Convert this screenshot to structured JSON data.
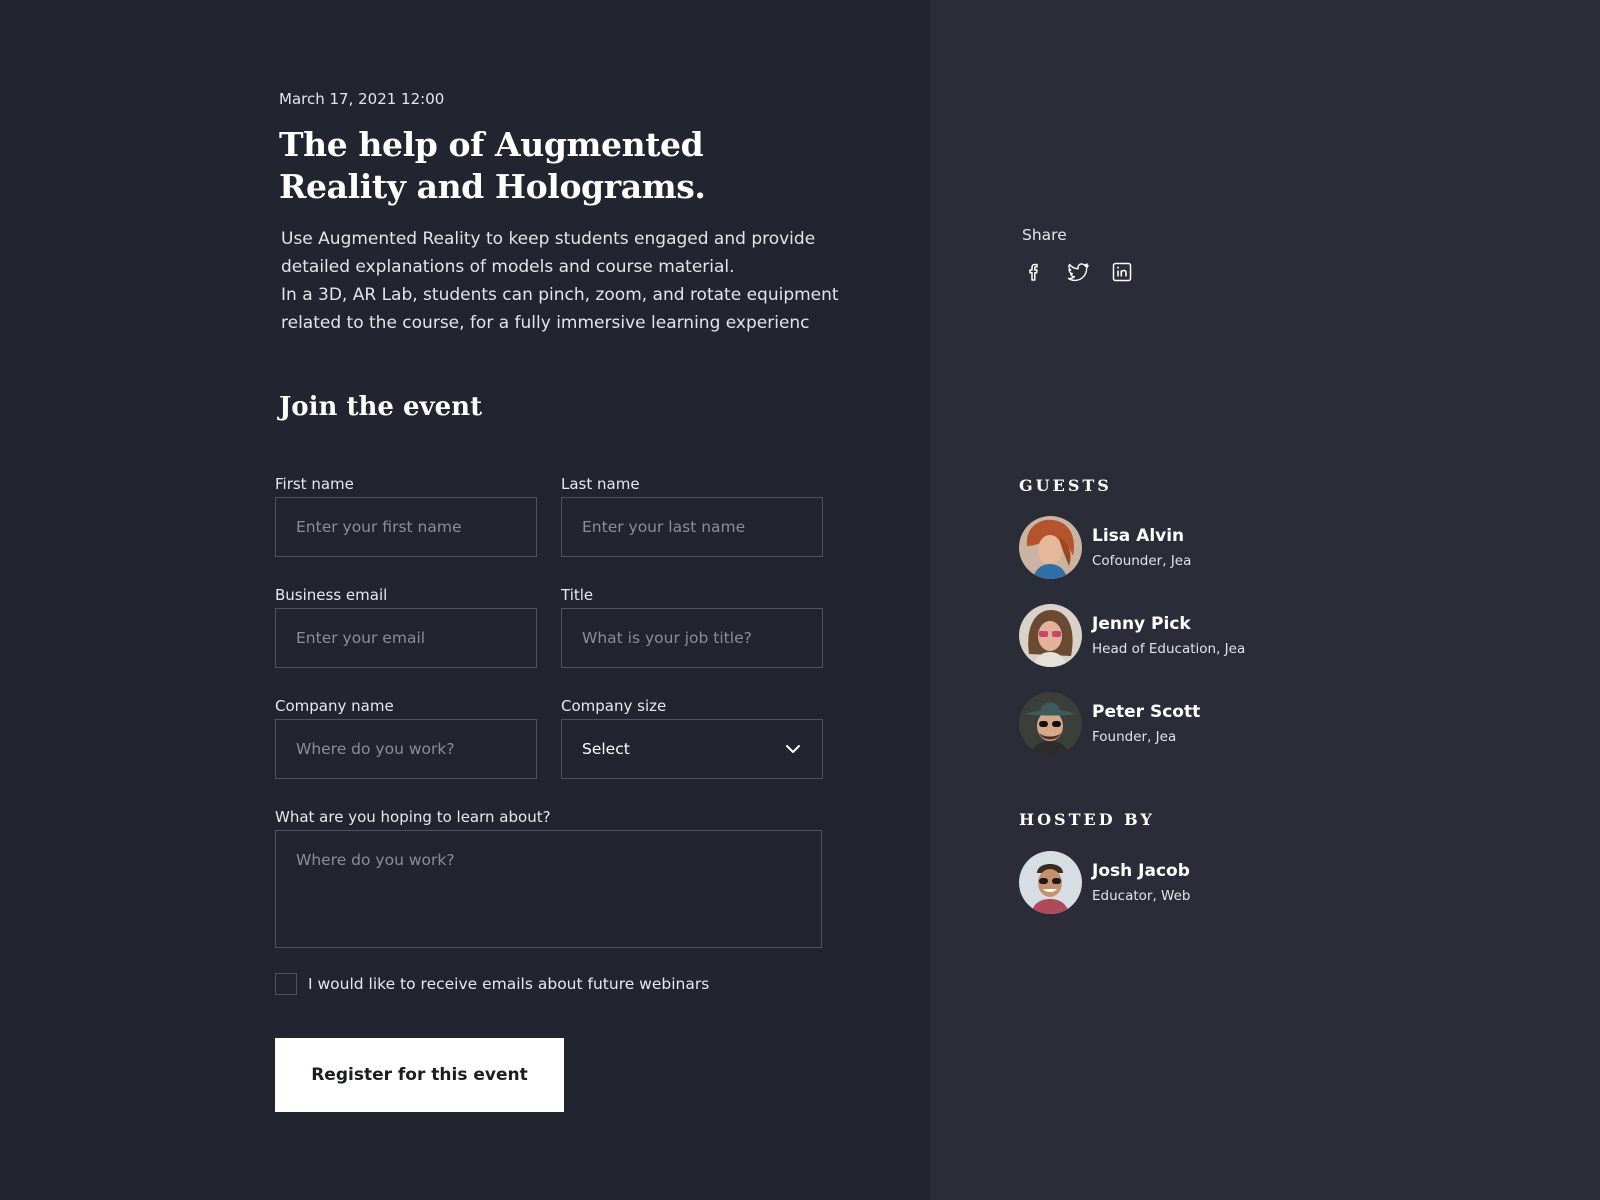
{
  "event": {
    "date": "March 17, 2021 12:00",
    "title": "The help of Augmented Reality and Holograms.",
    "description_1": "Use Augmented Reality to keep students engaged and provide detailed explanations of models and course material.",
    "description_2": "In a 3D, AR Lab, students can pinch, zoom, and rotate equipment related to the course, for a fully immersive learning experienc"
  },
  "form": {
    "heading": "Join the event",
    "first_name": {
      "label": "First name",
      "placeholder": "Enter your first name"
    },
    "last_name": {
      "label": "Last name",
      "placeholder": "Enter your last name"
    },
    "email": {
      "label": "Business email",
      "placeholder": "Enter your email"
    },
    "title": {
      "label": "Title",
      "placeholder": "What is your job title?"
    },
    "company_name": {
      "label": "Company name",
      "placeholder": "Where do you work?"
    },
    "company_size": {
      "label": "Company size",
      "value": "Select"
    },
    "learn": {
      "label": "What are you hoping to learn about?",
      "placeholder": "Where do you work?"
    },
    "newsletter": {
      "label": "I would like to receive emails about future webinars",
      "checked": false
    },
    "submit_label": "Register for this event"
  },
  "share": {
    "label": "Share",
    "icons": [
      "facebook-icon",
      "twitter-icon",
      "linkedin-icon"
    ]
  },
  "guests": {
    "heading": "GUESTS",
    "people": [
      {
        "name": "Lisa Alvin",
        "role": "Cofounder, Jea"
      },
      {
        "name": "Jenny Pick",
        "role": "Head of Education, Jea"
      },
      {
        "name": "Peter Scott",
        "role": "Founder, Jea"
      }
    ]
  },
  "host": {
    "heading": "HOSTED BY",
    "name": "Josh Jacob",
    "role": "Educator, Web"
  },
  "colors": {
    "left_background": "#22242f",
    "right_background": "#2a2c37",
    "border": "#50535f",
    "button_background": "#ffffff"
  }
}
